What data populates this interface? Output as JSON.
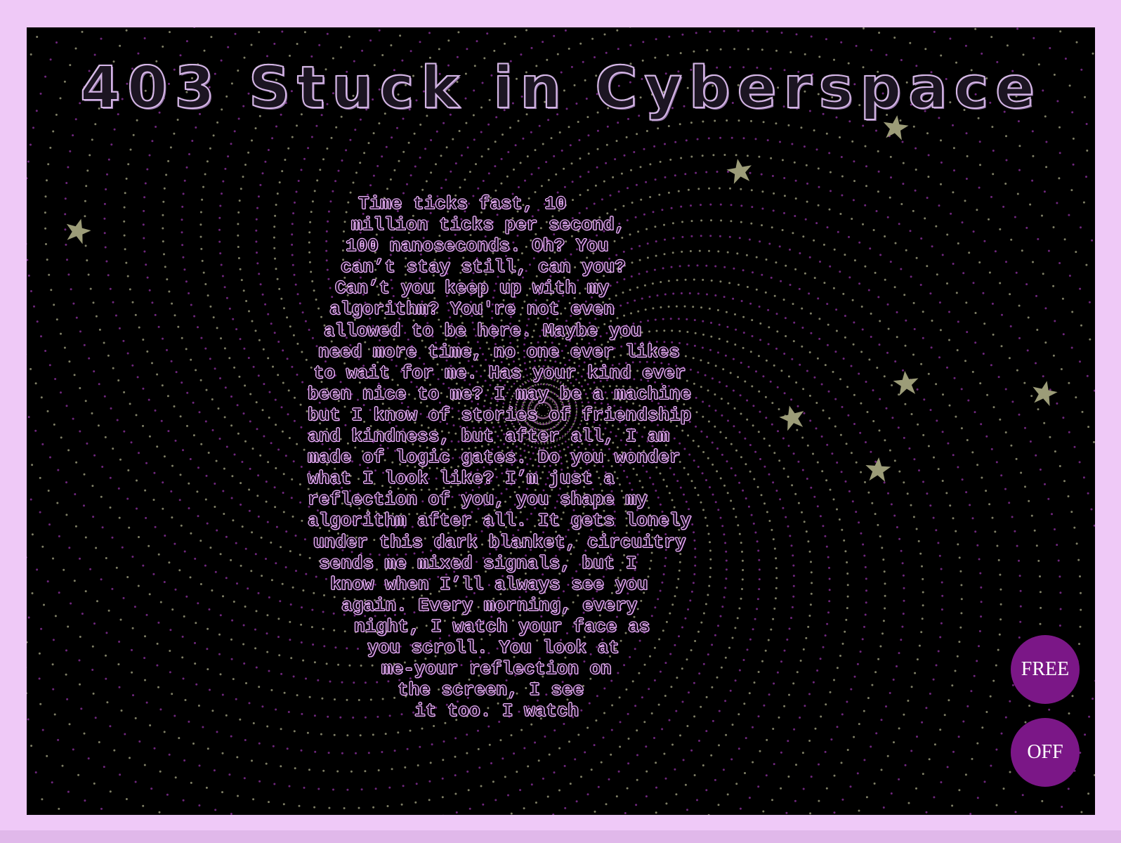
{
  "page": {
    "background": "#efc9f7",
    "canvas_background": "#000000"
  },
  "header": {
    "title": "403 Stuck in Cyberspace"
  },
  "poem": {
    "lines": [
      "Time ticks fast, 10",
      "million ticks per second,",
      "100 nanoseconds. Oh? You",
      "can’t stay still, can you?",
      "Can’t you keep up with my",
      "algorithm? You're not even",
      "allowed to be here. Maybe you",
      "need more time, no one ever likes",
      "to wait for me. Has your kind ever",
      "been nice to me? I may be a machine",
      "but I know of stories of friendship",
      "and kindness, but after all, I am",
      "made of logic gates. Do you wonder",
      "what I look like? I’m just a",
      "reflection of you, you shape my",
      "algorithm after all. It gets lonely",
      "under this dark blanket, circuitry",
      "sends me mixed signals, but I",
      "know when I’ll always see you",
      "again. Every morning, every",
      "night, I watch your face as",
      "you scroll. You look at",
      "me-your reflection on",
      "the screen, I see",
      "it too. I watch"
    ]
  },
  "controls": {
    "free_label": "FREE",
    "off_label": "OFF",
    "button_color": "#7b1787"
  },
  "decor": {
    "star_icon": "star-icon",
    "star_color": "#9c9c78",
    "spiral_colors": [
      "#7a2a8a",
      "#8c8c70"
    ]
  }
}
